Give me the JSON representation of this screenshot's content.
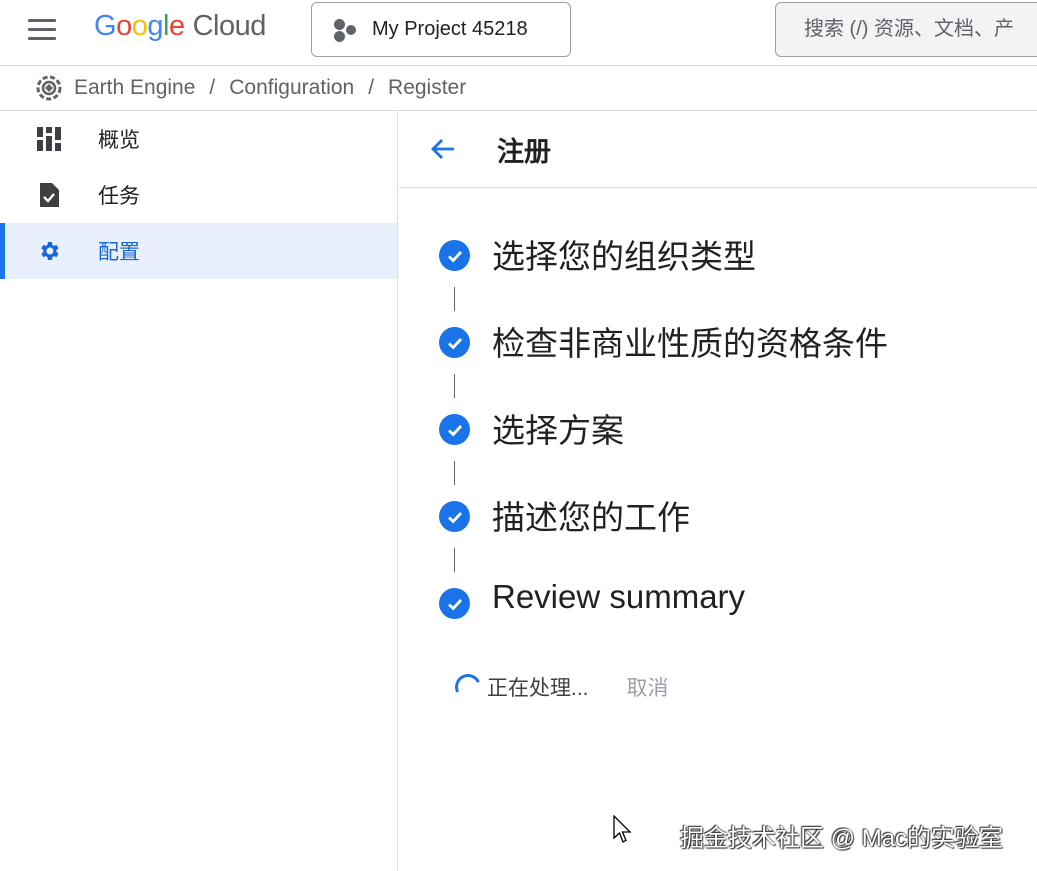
{
  "header": {
    "logo": {
      "G": "G",
      "o1": "o",
      "o2": "o",
      "g": "g",
      "l": "l",
      "e": "e",
      "cloud": "Cloud"
    },
    "project_label": "My Project 45218",
    "search_placeholder": "搜索 (/) 资源、文档、产"
  },
  "breadcrumb": {
    "items": [
      "Earth Engine",
      "Configuration",
      "Register"
    ],
    "separator": "/"
  },
  "sidebar": {
    "items": [
      {
        "label": "概览",
        "icon": "dashboard-icon",
        "active": false
      },
      {
        "label": "任务",
        "icon": "task-file-icon",
        "active": false
      },
      {
        "label": "配置",
        "icon": "gear-icon",
        "active": true
      }
    ]
  },
  "main": {
    "title": "注册",
    "steps": [
      {
        "label": "选择您的组织类型",
        "done": true
      },
      {
        "label": "检查非商业性质的资格条件",
        "done": true
      },
      {
        "label": "选择方案",
        "done": true
      },
      {
        "label": "描述您的工作",
        "done": true
      },
      {
        "label": "Review summary",
        "done": true
      }
    ],
    "processing_label": "正在处理...",
    "cancel_label": "取消"
  },
  "watermark": "掘金技术社区 @ Mac的实验室",
  "colors": {
    "accent": "#1a73e8",
    "active_bg": "#e8f0fe",
    "border": "#dadce0",
    "text": "#202124"
  }
}
